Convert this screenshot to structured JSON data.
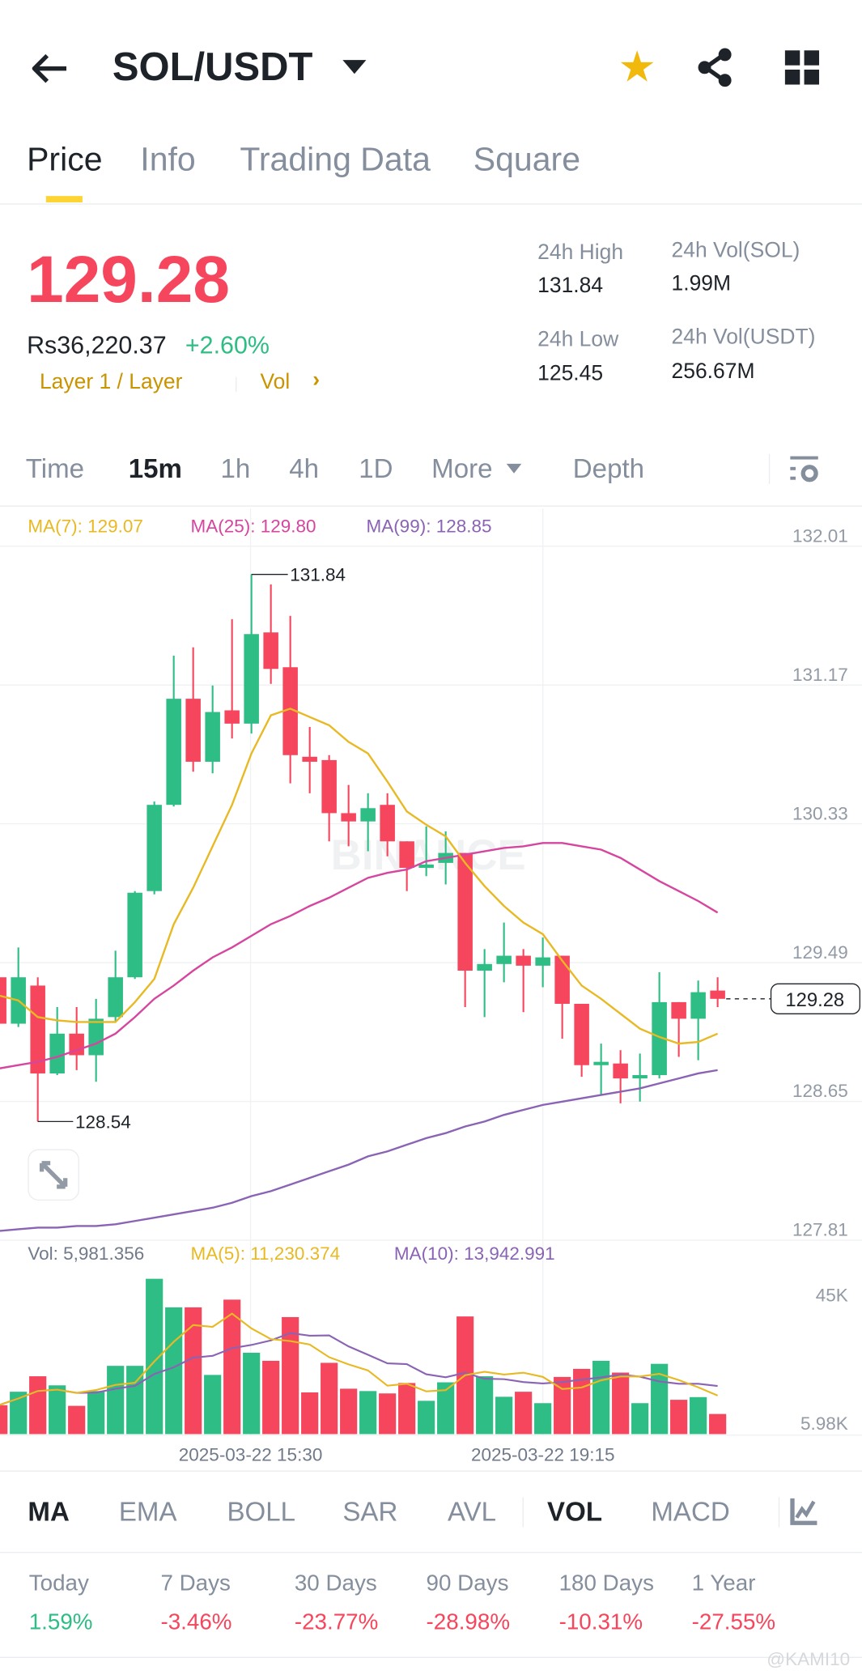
{
  "header": {
    "title": "SOL/USDT",
    "icons": [
      "back-arrow-icon",
      "dropdown-caret-icon",
      "star-icon",
      "share-icon",
      "grid-icon"
    ]
  },
  "tabs": [
    {
      "label": "Price",
      "active": true
    },
    {
      "label": "Info"
    },
    {
      "label": "Trading Data"
    },
    {
      "label": "Square"
    }
  ],
  "ticker": {
    "price": "129.28",
    "fiat": "Rs36,220.37",
    "change": "+2.60%",
    "tag": "Layer 1 / Layer",
    "vol_link": "Vol",
    "high_label": "24h High",
    "high": "131.84",
    "low_label": "24h Low",
    "low": "125.45",
    "vol_sol_label": "24h Vol(SOL)",
    "vol_sol": "1.99M",
    "vol_usdt_label": "24h Vol(USDT)",
    "vol_usdt": "256.67M"
  },
  "intervals": [
    {
      "label": "Time"
    },
    {
      "label": "15m",
      "active": true
    },
    {
      "label": "1h"
    },
    {
      "label": "4h"
    },
    {
      "label": "1D"
    },
    {
      "label": "More"
    },
    {
      "label": "Depth"
    }
  ],
  "colors": {
    "up": "#2EBD85",
    "down": "#F6465D",
    "ma7": "#E8B923",
    "ma25": "#D6459E",
    "ma99": "#8A63B4",
    "accent": "#FCD535"
  },
  "chart_data": {
    "type": "candlestick",
    "ma_legend": {
      "ma7": "MA(7): 129.07",
      "ma25": "MA(25): 129.80",
      "ma99": "MA(99): 128.85"
    },
    "y_ticks": [
      "132.01",
      "131.17",
      "130.33",
      "129.49",
      "128.65",
      "127.81"
    ],
    "ylim": [
      127.81,
      132.01
    ],
    "high_marker": "131.84",
    "low_marker": "128.54",
    "last_price": "129.28",
    "x_ticks": [
      "2025-03-22 15:30",
      "2025-03-22 19:15"
    ],
    "watermark": "BINANCE",
    "candles": [
      [
        129.41,
        129.44,
        129.1,
        129.13
      ],
      [
        129.13,
        129.59,
        129.11,
        129.41
      ],
      [
        129.36,
        129.41,
        128.54,
        128.83
      ],
      [
        128.83,
        129.23,
        128.82,
        129.07
      ],
      [
        129.07,
        129.23,
        128.85,
        128.94
      ],
      [
        128.94,
        129.28,
        128.78,
        129.16
      ],
      [
        129.17,
        129.57,
        129.14,
        129.41
      ],
      [
        129.41,
        129.93,
        129.4,
        129.92
      ],
      [
        129.93,
        130.47,
        129.91,
        130.45
      ],
      [
        130.45,
        131.35,
        130.44,
        131.09
      ],
      [
        131.09,
        131.4,
        130.65,
        130.71
      ],
      [
        130.71,
        131.17,
        130.64,
        131.01
      ],
      [
        131.02,
        131.57,
        130.85,
        130.94
      ],
      [
        130.94,
        131.84,
        130.88,
        131.48
      ],
      [
        131.49,
        131.78,
        131.18,
        131.27
      ],
      [
        131.28,
        131.59,
        130.58,
        130.75
      ],
      [
        130.74,
        130.92,
        130.52,
        130.71
      ],
      [
        130.72,
        130.75,
        130.23,
        130.4
      ],
      [
        130.4,
        130.57,
        130.2,
        130.35
      ],
      [
        130.35,
        130.52,
        130.17,
        130.43
      ],
      [
        130.45,
        130.52,
        130.14,
        130.23
      ],
      [
        130.23,
        130.23,
        129.93,
        130.07
      ],
      [
        130.07,
        130.32,
        130.02,
        130.09
      ],
      [
        130.1,
        130.29,
        129.97,
        130.16
      ],
      [
        130.16,
        130.16,
        129.23,
        129.45
      ],
      [
        129.45,
        129.58,
        129.17,
        129.49
      ],
      [
        129.49,
        129.74,
        129.38,
        129.54
      ],
      [
        129.54,
        129.58,
        129.2,
        129.48
      ],
      [
        129.48,
        129.65,
        129.35,
        129.53
      ],
      [
        129.54,
        129.54,
        129.04,
        129.25
      ],
      [
        129.25,
        129.25,
        128.81,
        128.88
      ],
      [
        128.88,
        129.01,
        128.7,
        128.9
      ],
      [
        128.89,
        128.97,
        128.65,
        128.8
      ],
      [
        128.8,
        128.95,
        128.66,
        128.82
      ],
      [
        128.82,
        129.44,
        128.8,
        129.26
      ],
      [
        129.26,
        129.26,
        128.93,
        129.16
      ],
      [
        129.16,
        129.39,
        128.91,
        129.32
      ],
      [
        129.33,
        129.41,
        129.23,
        129.28
      ]
    ],
    "ma7": [
      129.3,
      129.27,
      129.17,
      129.15,
      129.14,
      129.14,
      129.14,
      129.26,
      129.4,
      129.73,
      129.95,
      130.2,
      130.45,
      130.76,
      130.99,
      131.03,
      130.98,
      130.93,
      130.83,
      130.76,
      130.59,
      130.41,
      130.33,
      130.26,
      130.1,
      129.96,
      129.84,
      129.74,
      129.67,
      129.51,
      129.36,
      129.28,
      129.19,
      129.1,
      129.05,
      129.01,
      129.02,
      129.07
    ],
    "ma25": [
      128.86,
      128.88,
      128.9,
      128.93,
      128.97,
      129.01,
      129.07,
      129.17,
      129.28,
      129.36,
      129.45,
      129.53,
      129.59,
      129.66,
      129.73,
      129.78,
      129.84,
      129.89,
      129.95,
      130.01,
      130.04,
      130.06,
      130.11,
      130.13,
      130.15,
      130.17,
      130.19,
      130.2,
      130.22,
      130.22,
      130.2,
      130.18,
      130.13,
      130.06,
      129.99,
      129.93,
      129.87,
      129.8
    ],
    "ma99": [
      127.88,
      127.89,
      127.9,
      127.9,
      127.91,
      127.91,
      127.92,
      127.94,
      127.96,
      127.98,
      128.0,
      128.02,
      128.05,
      128.09,
      128.12,
      128.16,
      128.2,
      128.24,
      128.28,
      128.33,
      128.36,
      128.4,
      128.44,
      128.47,
      128.51,
      128.54,
      128.58,
      128.61,
      128.64,
      128.66,
      128.68,
      128.7,
      128.72,
      128.74,
      128.77,
      128.8,
      128.83,
      128.85
    ],
    "volume": {
      "legend": {
        "vol": "Vol: 5,981.356",
        "ma5": "MA(5): 11,230.374",
        "ma10": "MA(10): 13,942.991"
      },
      "y_ticks": [
        "45K",
        "5.98K"
      ],
      "values": [
        8600,
        12600,
        17200,
        14500,
        8400,
        12800,
        20300,
        20300,
        46200,
        37700,
        37700,
        17600,
        40000,
        24200,
        21800,
        34800,
        12400,
        21200,
        13500,
        12800,
        12100,
        15200,
        9900,
        15400,
        35000,
        17200,
        11100,
        12600,
        9200,
        17000,
        19400,
        21800,
        18300,
        9200,
        20900,
        10200,
        11000,
        5981
      ]
    }
  },
  "indicators": [
    {
      "label": "MA",
      "active": true
    },
    {
      "label": "EMA"
    },
    {
      "label": "BOLL"
    },
    {
      "label": "SAR"
    },
    {
      "label": "AVL"
    },
    {
      "label": "VOL",
      "active": true
    },
    {
      "label": "MACD"
    }
  ],
  "performance": [
    {
      "label": "Today",
      "value": "1.59%",
      "dir": "up"
    },
    {
      "label": "7 Days",
      "value": "-3.46%",
      "dir": "down"
    },
    {
      "label": "30 Days",
      "value": "-23.77%",
      "dir": "down"
    },
    {
      "label": "90 Days",
      "value": "-28.98%",
      "dir": "down"
    },
    {
      "label": "180 Days",
      "value": "-10.31%",
      "dir": "down"
    },
    {
      "label": "1 Year",
      "value": "-27.55%",
      "dir": "down"
    }
  ],
  "watermark_user": "@KAMI10"
}
